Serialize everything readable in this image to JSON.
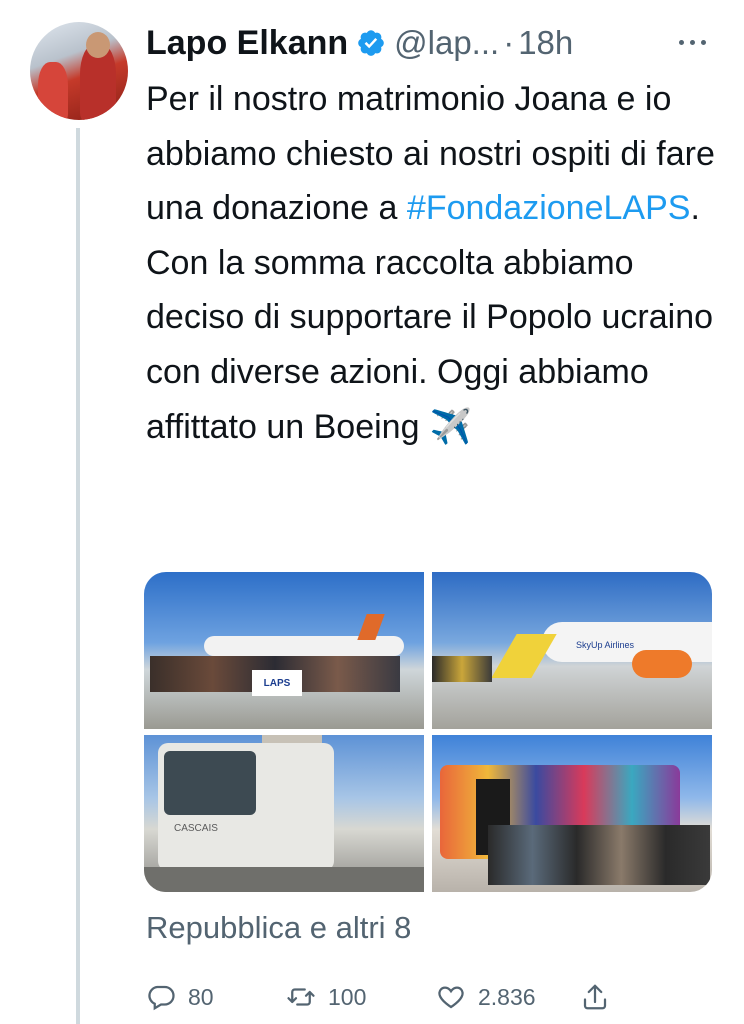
{
  "author": {
    "name": "Lapo Elkann",
    "handle": "@lap...",
    "separator": "·",
    "time": "18h",
    "verified_icon": "verified-badge-icon"
  },
  "tweet": {
    "text_before": "Per il nostro matrimonio Joana e io abbiamo chiesto ai nostri ospiti di fare una donazione a ",
    "hashtag": "#FondazioneLAPS",
    "text_after": ". Con la somma raccolta abbiamo deciso di supportare il Popolo ucraino con diverse azioni. Oggi abbiamo affittato un Boeing",
    "emoji": "✈️"
  },
  "media": {
    "photo_count": 4,
    "banner_text": "LAPS",
    "airline_text": "SkyUp Airlines",
    "bus_text": "CASCAIS"
  },
  "social_context": "Repubblica e altri 8",
  "actions": {
    "reply_count": "80",
    "retweet_count": "100",
    "like_count": "2.836"
  },
  "colors": {
    "accent": "#1d9bf0",
    "text": "#0f1419",
    "secondary": "#536471",
    "thread_line": "#cfd9de"
  }
}
